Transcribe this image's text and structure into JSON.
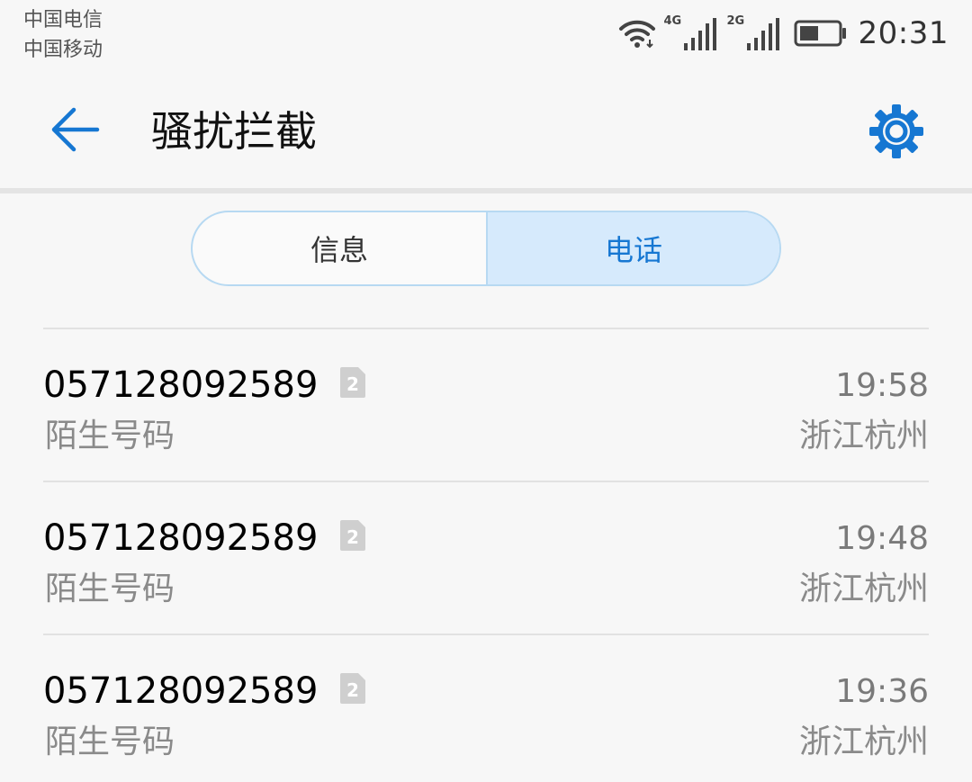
{
  "status_bar": {
    "carrier_1": "中国电信",
    "carrier_2": "中国移动",
    "network_1": "4G",
    "network_2": "2G",
    "time": "20:31",
    "icons": [
      "wifi-icon",
      "signal-4g-icon",
      "signal-2g-icon",
      "battery-icon"
    ]
  },
  "header": {
    "title": "骚扰拦截",
    "back_icon": "arrow-left-icon",
    "settings_icon": "gear-icon"
  },
  "tabs": [
    {
      "label": "信息",
      "active": false
    },
    {
      "label": "电话",
      "active": true
    }
  ],
  "calls": [
    {
      "number": "057128092589",
      "sim": "2",
      "desc": "陌生号码",
      "time": "19:58",
      "location": "浙江杭州"
    },
    {
      "number": "057128092589",
      "sim": "2",
      "desc": "陌生号码",
      "time": "19:48",
      "location": "浙江杭州"
    },
    {
      "number": "057128092589",
      "sim": "2",
      "desc": "陌生号码",
      "time": "19:36",
      "location": "浙江杭州"
    }
  ],
  "colors": {
    "accent": "#1677d2",
    "tab_active_bg": "#d6eafc",
    "tab_border": "#b7d9f2",
    "secondary_text": "#8a8a8a"
  }
}
